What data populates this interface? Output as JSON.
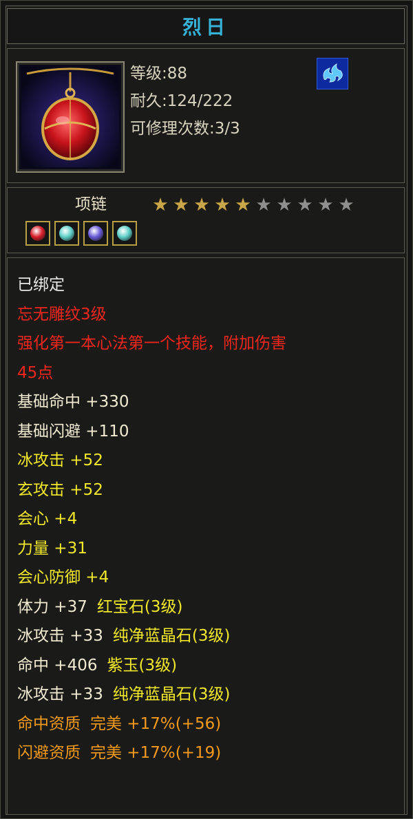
{
  "title": "烈日",
  "item": {
    "icon": "necklace-icon",
    "stats": [
      "等级:88",
      "耐久:124/222",
      "可修理次数:3/3"
    ],
    "badge_icon": "blue-flame-icon"
  },
  "slot": {
    "type": "项链",
    "stars_total": 10,
    "stars_filled": 5
  },
  "gems": [
    {
      "icon": "red-gem-icon",
      "color": "#d7202a"
    },
    {
      "icon": "cyan-gem-icon",
      "color": "#5fd0c8"
    },
    {
      "icon": "purple-gem-icon",
      "color": "#6a5bd6"
    },
    {
      "icon": "cyan-gem-icon",
      "color": "#5fd0c8"
    }
  ],
  "attributes": [
    {
      "segs": [
        {
          "text": "已绑定",
          "color": "white"
        }
      ]
    },
    {
      "segs": [
        {
          "text": "忘无雕纹3级",
          "color": "red"
        }
      ]
    },
    {
      "segs": [
        {
          "text": "强化第一本心法第一个技能，附加伤害",
          "color": "red"
        }
      ]
    },
    {
      "segs": [
        {
          "text": "45点",
          "color": "red"
        }
      ]
    },
    {
      "segs": [
        {
          "text": "基础命中 +330",
          "color": "cream"
        }
      ]
    },
    {
      "segs": [
        {
          "text": "基础闪避 +110",
          "color": "cream"
        }
      ]
    },
    {
      "segs": [
        {
          "text": "冰攻击 +52",
          "color": "yellow"
        }
      ]
    },
    {
      "segs": [
        {
          "text": "玄攻击 +52",
          "color": "yellow"
        }
      ]
    },
    {
      "segs": [
        {
          "text": "会心 +4",
          "color": "yellow"
        }
      ]
    },
    {
      "segs": [
        {
          "text": "力量 +31",
          "color": "yellow"
        }
      ]
    },
    {
      "segs": [
        {
          "text": "会心防御 +4",
          "color": "yellow"
        }
      ]
    },
    {
      "segs": [
        {
          "text": "体力 +37",
          "color": "cream"
        },
        {
          "text": "红宝石(3级)",
          "color": "yellow"
        }
      ]
    },
    {
      "segs": [
        {
          "text": "冰攻击 +33",
          "color": "cream"
        },
        {
          "text": "纯净蓝晶石(3级)",
          "color": "yellow"
        }
      ]
    },
    {
      "segs": [
        {
          "text": "命中 +406",
          "color": "cream"
        },
        {
          "text": "紫玉(3级)",
          "color": "yellow"
        }
      ]
    },
    {
      "segs": [
        {
          "text": "冰攻击 +33",
          "color": "cream"
        },
        {
          "text": "纯净蓝晶石(3级)",
          "color": "yellow"
        }
      ]
    },
    {
      "segs": [
        {
          "text": "命中资质",
          "color": "orange"
        },
        {
          "text": "完美 +17%(+56)",
          "color": "orange"
        }
      ]
    },
    {
      "segs": [
        {
          "text": "闪避资质",
          "color": "orange"
        },
        {
          "text": "完美 +17%(+19)",
          "color": "orange"
        }
      ]
    }
  ]
}
